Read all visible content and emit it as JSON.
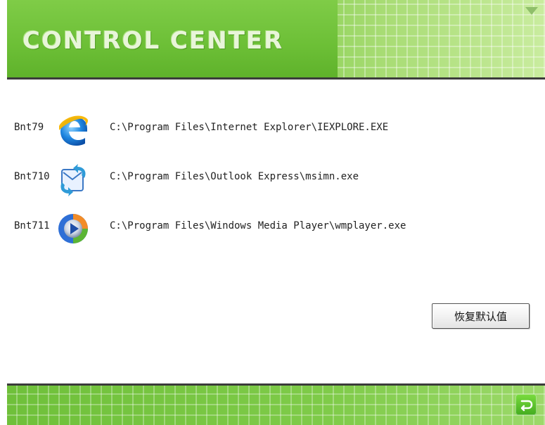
{
  "window": {
    "title": "CONTROL CENTER",
    "menu_icon": "dropdown-arrow-icon"
  },
  "entries": [
    {
      "key": "Bnt79",
      "icon": "internet-explorer-icon",
      "path": "C:\\Program Files\\Internet Explorer\\IEXPLORE.EXE"
    },
    {
      "key": "Bnt710",
      "icon": "outlook-express-icon",
      "path": "C:\\Program Files\\Outlook Express\\msimn.exe"
    },
    {
      "key": "Bnt711",
      "icon": "windows-media-player-icon",
      "path": "C:\\Program Files\\Windows Media Player\\wmplayer.exe"
    }
  ],
  "buttons": {
    "restore_default": "恢复默认值",
    "back_icon": "back-arrow-icon"
  },
  "colors": {
    "accent_green": "#6bbf34",
    "divider": "#3b3b3b"
  }
}
